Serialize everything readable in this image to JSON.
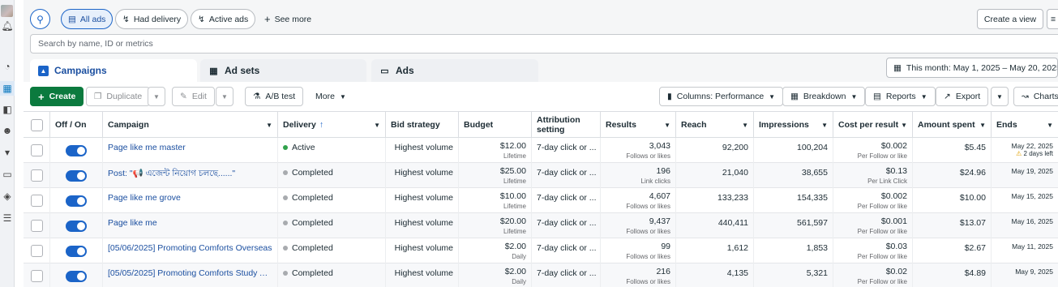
{
  "top_filters": {
    "all_ads": "All ads",
    "had_delivery": "Had delivery",
    "active_ads": "Active ads",
    "see_more": "See more",
    "create_view": "Create a view"
  },
  "search": {
    "placeholder": "Search by name, ID or metrics"
  },
  "tabs": [
    {
      "label": "Campaigns"
    },
    {
      "label": "Ad sets"
    },
    {
      "label": "Ads"
    }
  ],
  "date_range": "This month: May 1, 2025 – May 20, 2025",
  "toolbar": {
    "create": "Create",
    "duplicate": "Duplicate",
    "edit": "Edit",
    "ab_test": "A/B test",
    "more": "More",
    "columns": "Columns: Performance",
    "breakdown": "Breakdown",
    "reports": "Reports",
    "export": "Export",
    "charts": "Charts"
  },
  "columns": {
    "off_on": "Off / On",
    "campaign": "Campaign",
    "delivery": "Delivery",
    "bid_strategy": "Bid strategy",
    "budget": "Budget",
    "attribution_1": "Attribution",
    "attribution_2": "setting",
    "results": "Results",
    "reach": "Reach",
    "impressions": "Impressions",
    "cost_per_result": "Cost per result",
    "amount_spent": "Amount spent",
    "ends": "Ends"
  },
  "rows": [
    {
      "name": "Page like me master",
      "delivery": "Active",
      "status_color": "#31a24c",
      "bid": "Highest volume",
      "budget": "$12.00",
      "budget_type": "Lifetime",
      "attribution": "7-day click or ...",
      "results": "3,043",
      "results_type": "Follows or likes",
      "reach": "92,200",
      "impressions": "100,204",
      "cpr": "$0.002",
      "cpr_type": "Per Follow or like",
      "spent": "$5.45",
      "ends": "May 22, 2025",
      "ends_note": "2 days left"
    },
    {
      "name": "Post: \"📢 এজেন্ট নিয়োগ চলছে......\"",
      "delivery": "Completed",
      "status_color": "#a8abaf",
      "bid": "Highest volume",
      "budget": "$25.00",
      "budget_type": "Lifetime",
      "attribution": "7-day click or ...",
      "results": "196",
      "results_type": "Link clicks",
      "reach": "21,040",
      "impressions": "38,655",
      "cpr": "$0.13",
      "cpr_type": "Per Link Click",
      "spent": "$24.96",
      "ends": "May 19, 2025",
      "ends_note": ""
    },
    {
      "name": "Page like me grove",
      "delivery": "Completed",
      "status_color": "#a8abaf",
      "bid": "Highest volume",
      "budget": "$10.00",
      "budget_type": "Lifetime",
      "attribution": "7-day click or ...",
      "results": "4,607",
      "results_type": "Follows or likes",
      "reach": "133,233",
      "impressions": "154,335",
      "cpr": "$0.002",
      "cpr_type": "Per Follow or like",
      "spent": "$10.00",
      "ends": "May 15, 2025",
      "ends_note": ""
    },
    {
      "name": "Page like me",
      "delivery": "Completed",
      "status_color": "#a8abaf",
      "bid": "Highest volume",
      "budget": "$20.00",
      "budget_type": "Lifetime",
      "attribution": "7-day click or ...",
      "results": "9,437",
      "results_type": "Follows or likes",
      "reach": "440,411",
      "impressions": "561,597",
      "cpr": "$0.001",
      "cpr_type": "Per Follow or like",
      "spent": "$13.07",
      "ends": "May 16, 2025",
      "ends_note": ""
    },
    {
      "name": "[05/06/2025] Promoting Comforts Overseas",
      "delivery": "Completed",
      "status_color": "#a8abaf",
      "bid": "Highest volume",
      "budget": "$2.00",
      "budget_type": "Daily",
      "attribution": "7-day click or ...",
      "results": "99",
      "results_type": "Follows or likes",
      "reach": "1,612",
      "impressions": "1,853",
      "cpr": "$0.03",
      "cpr_type": "Per Follow or like",
      "spent": "$2.67",
      "ends": "May 11, 2025",
      "ends_note": ""
    },
    {
      "name": "[05/05/2025] Promoting Comforts Study Abr...",
      "delivery": "Completed",
      "status_color": "#a8abaf",
      "bid": "Highest volume",
      "budget": "$2.00",
      "budget_type": "Daily",
      "attribution": "7-day click or ...",
      "results": "216",
      "results_type": "Follows or likes",
      "reach": "4,135",
      "impressions": "5,321",
      "cpr": "$0.02",
      "cpr_type": "Per Follow or like",
      "spent": "$4.89",
      "ends": "May 9, 2025",
      "ends_note": ""
    }
  ],
  "colors": {
    "accent": "#1b64c8",
    "create": "#0b7a3e",
    "active": "#31a24c",
    "completed": "#a8abaf"
  }
}
